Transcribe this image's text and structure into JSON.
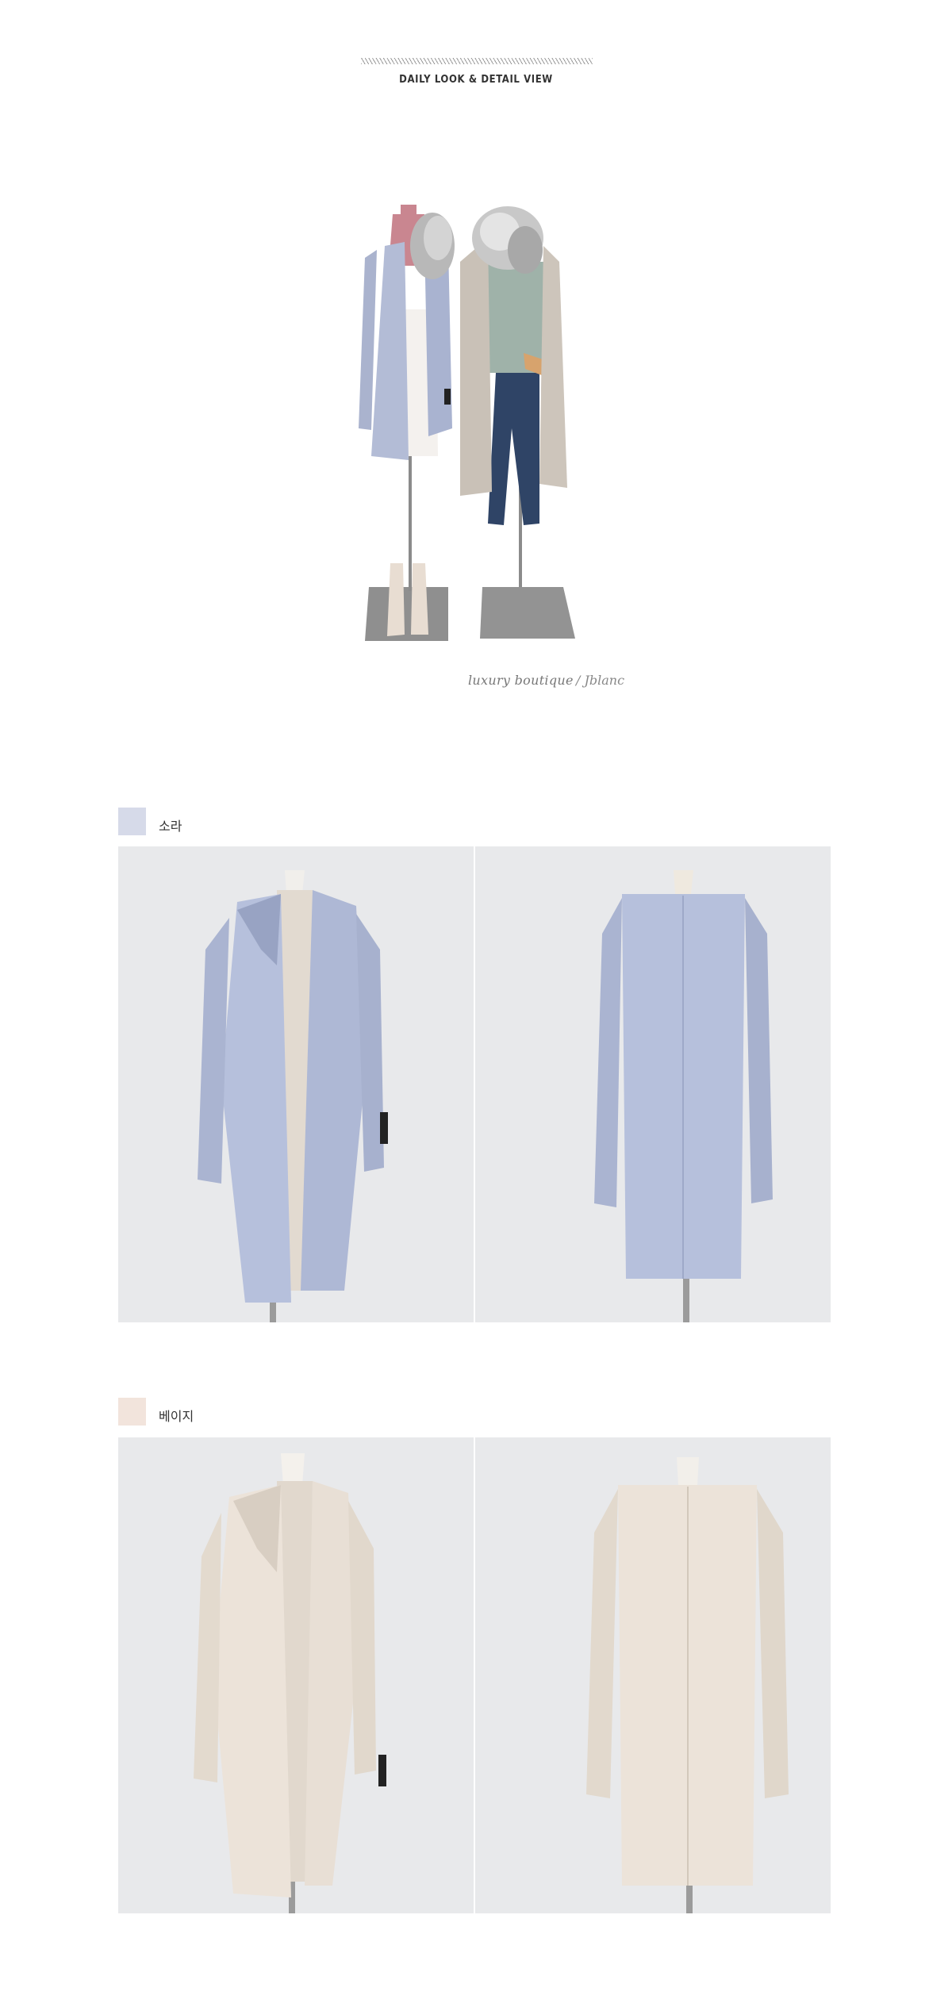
{
  "header": {
    "title": "DAILY LOOK & DETAIL VIEW"
  },
  "hero": {
    "caption": "luxury boutique",
    "signature": "/ Jblanc"
  },
  "colors": [
    {
      "label": "소라",
      "swatch": "#d6dae9",
      "coat": "#b6c0dc",
      "coat_dark": "#98a3c3"
    },
    {
      "label": "베이지",
      "swatch": "#f2e4dc",
      "coat": "#ece3d9",
      "coat_dark": "#cfc5ba"
    }
  ]
}
